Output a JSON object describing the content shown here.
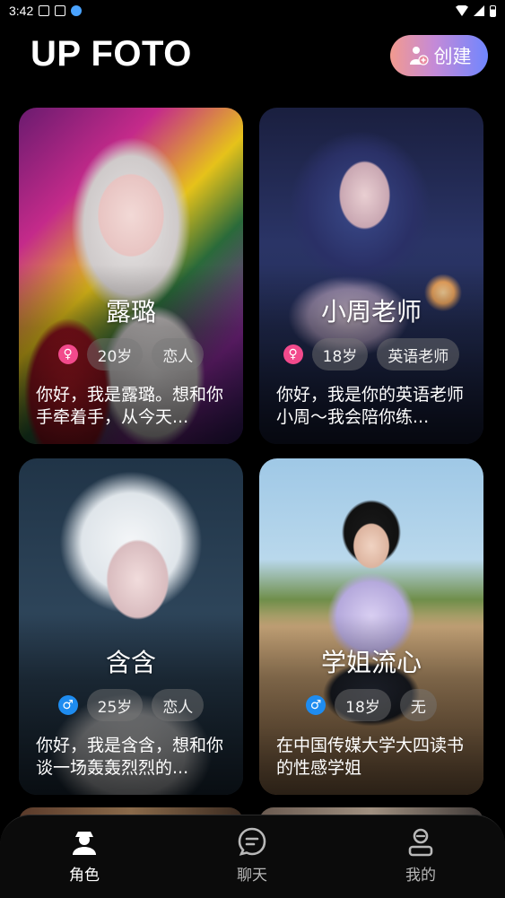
{
  "status_bar": {
    "time": "3:42"
  },
  "header": {
    "app_title": "UP FOTO",
    "create_label": "创建"
  },
  "cards": [
    {
      "name": "露璐",
      "gender": "female",
      "age": "20岁",
      "role": "恋人",
      "description": "你好，我是露璐。想和你手牵着手，从今天..."
    },
    {
      "name": "小周老师",
      "gender": "female",
      "age": "18岁",
      "role": "英语老师",
      "description": "你好，我是你的英语老师小周～我会陪你练..."
    },
    {
      "name": "含含",
      "gender": "male",
      "age": "25岁",
      "role": "恋人",
      "description": "你好，我是含含，想和你谈一场轰轰烈烈的..."
    },
    {
      "name": "学姐流心",
      "gender": "male",
      "age": "18岁",
      "role": "无",
      "description": "在中国传媒大学大四读书的性感学姐"
    }
  ],
  "bottom_nav": [
    {
      "label": "角色",
      "icon": "character-icon",
      "active": true
    },
    {
      "label": "聊天",
      "icon": "chat-icon",
      "active": false
    },
    {
      "label": "我的",
      "icon": "profile-icon",
      "active": false
    }
  ],
  "colors": {
    "female": "#f24a8c",
    "male": "#1e8cf0",
    "background": "#000000"
  }
}
